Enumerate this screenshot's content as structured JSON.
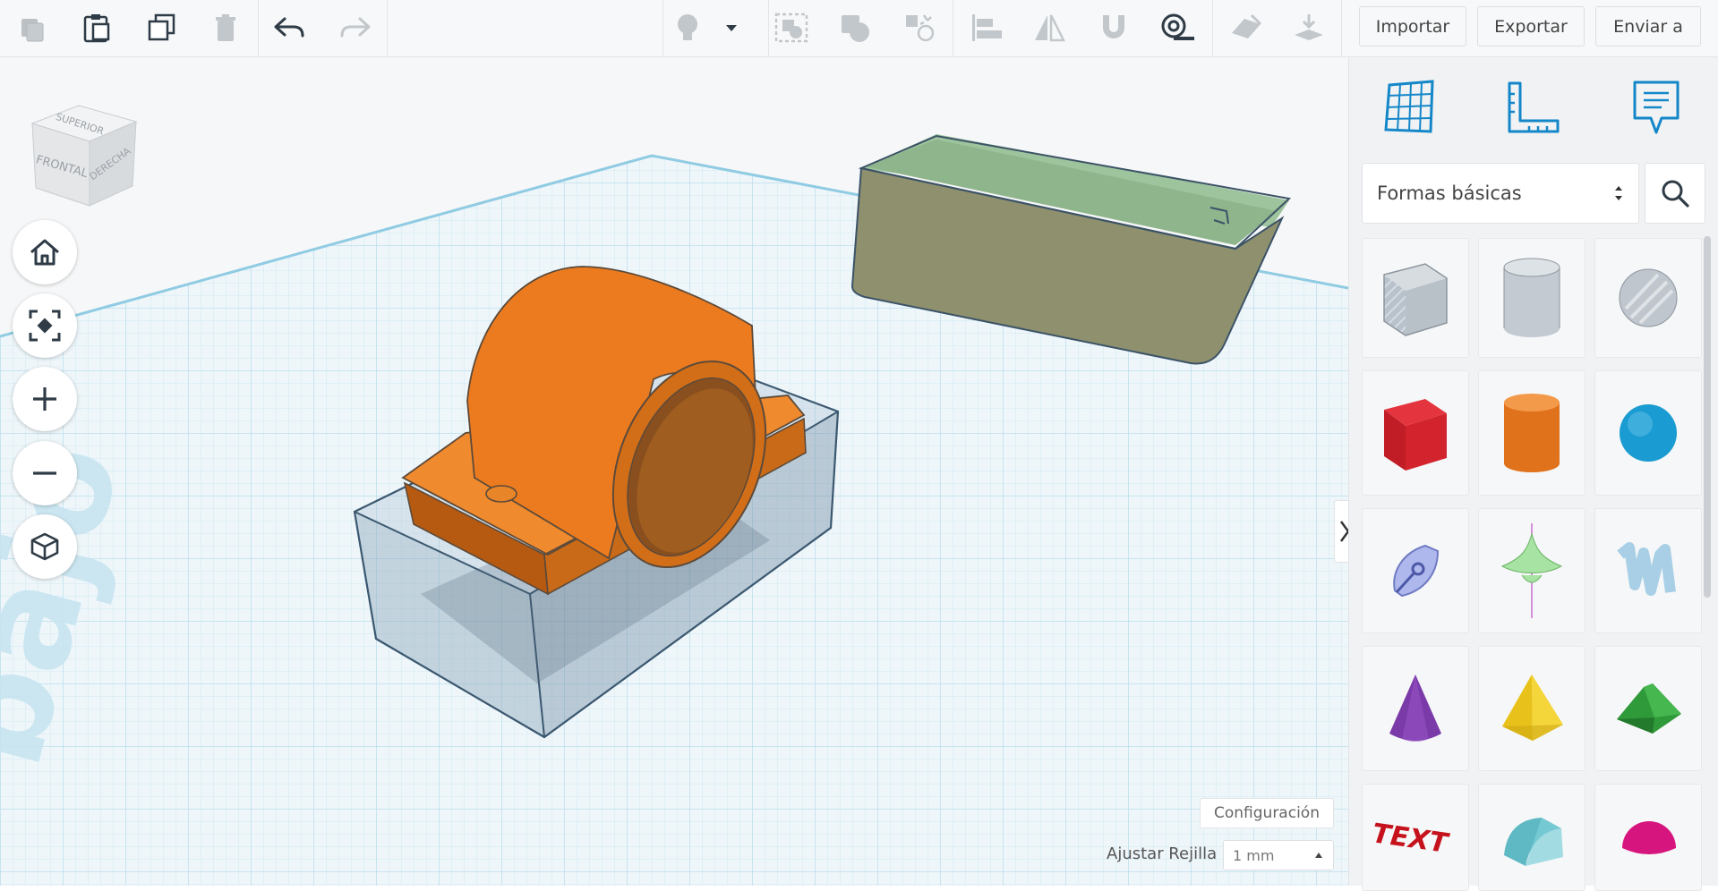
{
  "toolbar": {
    "icons": [
      "copy-icon",
      "paste-icon",
      "duplicate-icon",
      "delete-icon",
      "undo-icon",
      "redo-icon",
      "lightbulb-icon",
      "dropdown-arrow-icon",
      "group-icon",
      "union-icon",
      "ungroup-icon",
      "align-icon",
      "mirror-icon",
      "magnet-icon",
      "ruler-icon",
      "workplane-icon",
      "drop-icon"
    ],
    "import_label": "Importar",
    "export_label": "Exportar",
    "send_label": "Enviar a"
  },
  "viewcube": {
    "top": "SUPERIOR",
    "front": "FRONTAL",
    "right": "DERECHA"
  },
  "workplane": {
    "watermark": "bajo",
    "settings_label": "Configuración",
    "snap_label": "Ajustar Rejilla",
    "snap_value": "1 mm",
    "colors": {
      "grid": "#bfe0ee",
      "orange": "#ec7b1f",
      "box_green": "#8e906e",
      "lid_green": "#8fb58c"
    }
  },
  "panel": {
    "icons": [
      "grid-view-icon",
      "ruler-icon",
      "notes-icon"
    ],
    "category": "Formas básicas",
    "shapes": [
      "box-hole",
      "cylinder-hole",
      "sphere-hole",
      "box",
      "cylinder",
      "sphere",
      "scribble",
      "paraboloid",
      "text-3d",
      "cone",
      "pyramid",
      "roof",
      "text",
      "half-cylinder",
      "half-sphere"
    ],
    "text_shape_label": "TEXT"
  }
}
